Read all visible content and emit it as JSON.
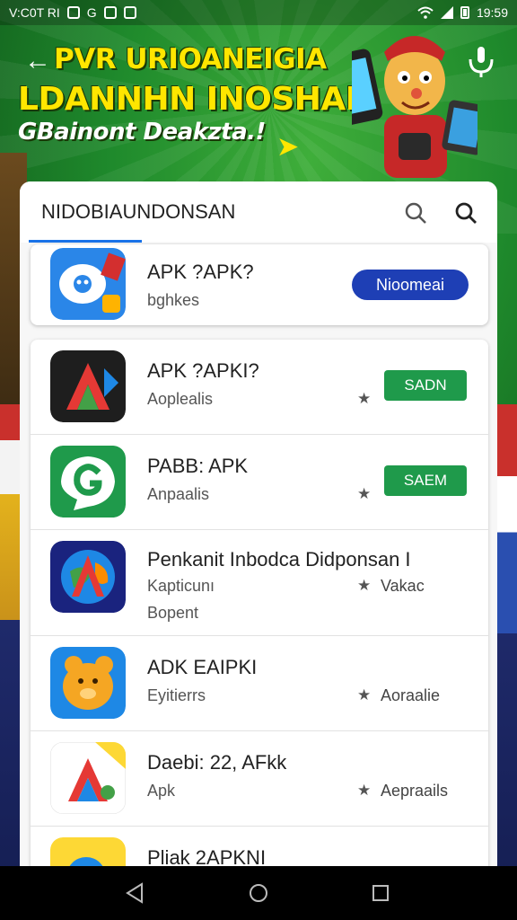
{
  "status_bar": {
    "left_text": "V:C0T RI",
    "time": "19:59"
  },
  "header": {
    "line1": "PVR URIOANEIGIA",
    "line2": "LDANNHN INOSHAN",
    "line3": "GBainont Deakzta.!"
  },
  "card": {
    "title": "NIDOBIAUNDONSAN",
    "featured": {
      "name": "APK ?APK?",
      "sub": "bghkes",
      "button": "Nioomeai"
    },
    "apps": [
      {
        "name": "APK ?APKI?",
        "sub": "Aoplealis",
        "button": "SADN"
      },
      {
        "name": "PABB: APK",
        "sub": "Anpaalis",
        "button": "SAEM"
      },
      {
        "name": "Penkanit Inbodca Didponsan I",
        "sub": "Kapticunı",
        "sub2": "Bopent",
        "meta": "Vakac"
      },
      {
        "name": "ADK EAIPKI",
        "sub": "Eyitierrs",
        "meta": "Aoraalie"
      },
      {
        "name": "Daebi: 22, AFkk",
        "sub": "Apk",
        "meta": "Aepraails"
      },
      {
        "name": "Pliak 2APKNI"
      }
    ]
  },
  "colors": {
    "accent_blue": "#1e3fb5",
    "accent_green": "#1f9a4b",
    "tab_underline": "#1a73e8"
  }
}
